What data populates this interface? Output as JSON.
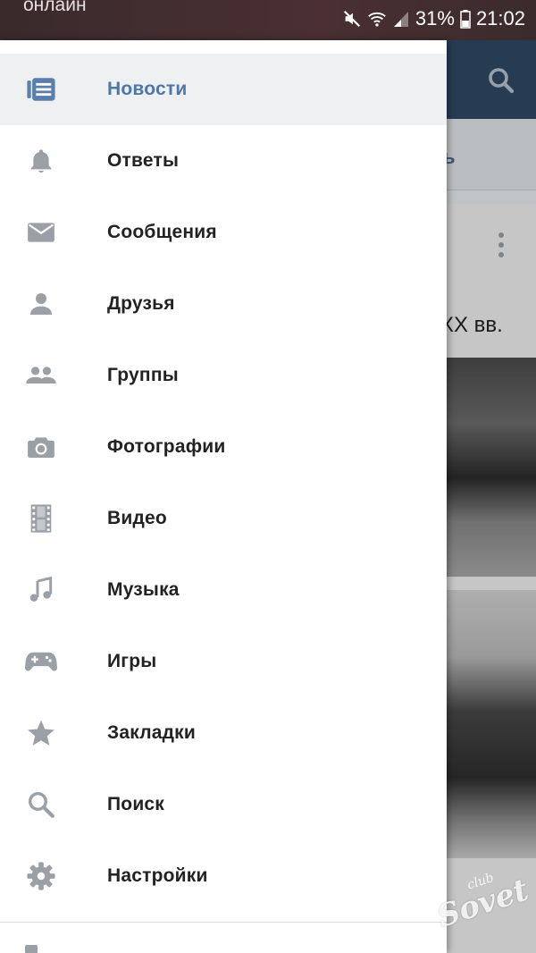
{
  "status_bar": {
    "left_text": "онлайн",
    "battery": "31%",
    "time": "21:02"
  },
  "background": {
    "subbar_text": "ь",
    "post_title_fragment": "XX вв."
  },
  "drawer": {
    "active_color": "#4d77a8",
    "icon_color": "#9aa0a6",
    "items": [
      {
        "label": "Новости",
        "icon": "news-icon",
        "active": true
      },
      {
        "label": "Ответы",
        "icon": "bell-icon",
        "active": false
      },
      {
        "label": "Сообщения",
        "icon": "envelope-icon",
        "active": false
      },
      {
        "label": "Друзья",
        "icon": "person-icon",
        "active": false
      },
      {
        "label": "Группы",
        "icon": "group-icon",
        "active": false
      },
      {
        "label": "Фотографии",
        "icon": "camera-icon",
        "active": false
      },
      {
        "label": "Видео",
        "icon": "film-icon",
        "active": false
      },
      {
        "label": "Музыка",
        "icon": "music-note-icon",
        "active": false
      },
      {
        "label": "Игры",
        "icon": "gamepad-icon",
        "active": false
      },
      {
        "label": "Закладки",
        "icon": "star-icon",
        "active": false
      },
      {
        "label": "Поиск",
        "icon": "search-icon",
        "active": false
      },
      {
        "label": "Настройки",
        "icon": "gear-icon",
        "active": false
      }
    ]
  },
  "watermark": {
    "small": "club",
    "large": "Sovet"
  }
}
